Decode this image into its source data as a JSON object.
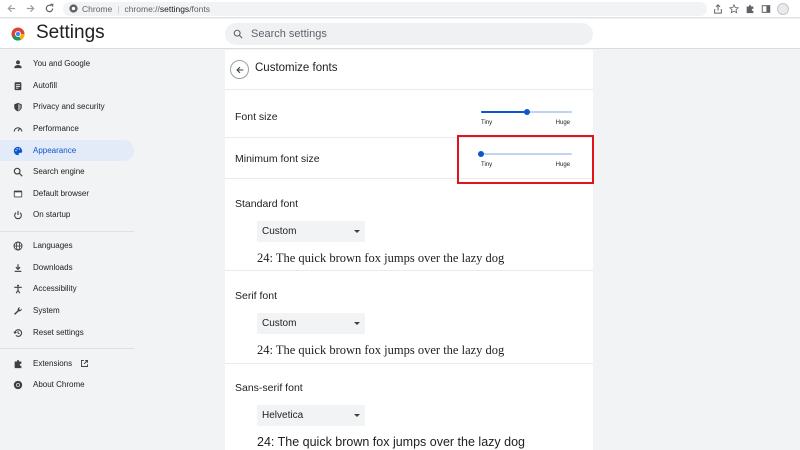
{
  "browser": {
    "site_label": "Chrome",
    "url_prefix": "chrome://",
    "url_path": "settings",
    "url_suffix": "/fonts"
  },
  "header": {
    "title": "Settings",
    "search_placeholder": "Search settings"
  },
  "sidebar": {
    "items": [
      {
        "label": "You and Google",
        "icon": "person-icon"
      },
      {
        "label": "Autofill",
        "icon": "clipboard-icon"
      },
      {
        "label": "Privacy and security",
        "icon": "shield-icon"
      },
      {
        "label": "Performance",
        "icon": "speedometer-icon"
      },
      {
        "label": "Appearance",
        "icon": "palette-icon",
        "active": true
      },
      {
        "label": "Search engine",
        "icon": "search-icon"
      },
      {
        "label": "Default browser",
        "icon": "browser-window-icon"
      },
      {
        "label": "On startup",
        "icon": "power-icon"
      },
      {
        "label": "Languages",
        "icon": "globe-icon"
      },
      {
        "label": "Downloads",
        "icon": "download-icon"
      },
      {
        "label": "Accessibility",
        "icon": "accessibility-icon"
      },
      {
        "label": "System",
        "icon": "wrench-icon"
      },
      {
        "label": "Reset settings",
        "icon": "history-icon"
      },
      {
        "label": "Extensions",
        "icon": "puzzle-icon"
      },
      {
        "label": "About Chrome",
        "icon": "chrome-logo-icon"
      }
    ]
  },
  "main": {
    "title": "Customize fonts",
    "font_size": {
      "label": "Font size",
      "min_label": "Tiny",
      "max_label": "Huge",
      "value_fraction": 0.5
    },
    "min_font_size": {
      "label": "Minimum font size",
      "min_label": "Tiny",
      "max_label": "Huge",
      "value_fraction": 0.0
    },
    "standard_font": {
      "label": "Standard font",
      "selected": "Custom",
      "sample": "24: The quick brown fox jumps over the lazy dog"
    },
    "serif_font": {
      "label": "Serif font",
      "selected": "Custom",
      "sample": "24: The quick brown fox jumps over the lazy dog"
    },
    "sans_serif_font": {
      "label": "Sans-serif font",
      "selected": "Helvetica",
      "sample": "24: The quick brown fox jumps over the lazy dog"
    }
  },
  "colors": {
    "accent": "#0b57d0",
    "active_nav_bg": "#e3ebf8",
    "highlight_border": "#e0141b"
  }
}
